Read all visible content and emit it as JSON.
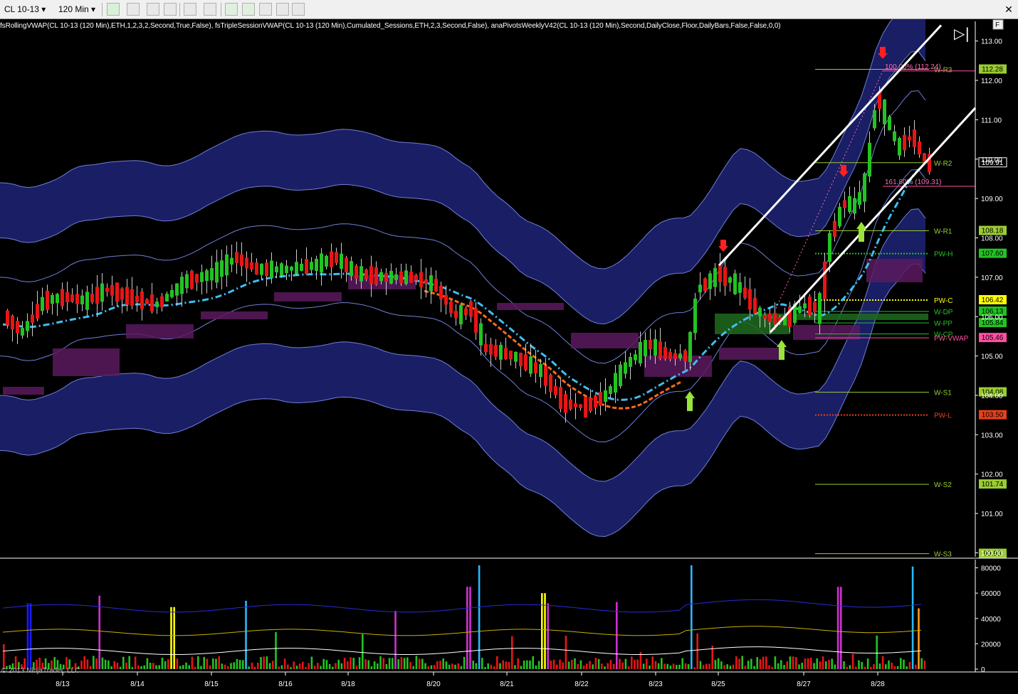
{
  "toolbar": {
    "instrument": "CL 10-13",
    "timeframe": "120 Min",
    "close_glyph": "✕",
    "buttons": [
      "bar-style-icon",
      "draw-pencil-icon",
      "draw-tools-icon",
      "properties-icon",
      "crosshair-icon",
      "zoom-icon",
      "chart-trader-icon",
      "data-box-icon",
      "indicators-icon",
      "strategies-icon",
      "template-icon"
    ]
  },
  "indicator_label": "fsRollingVWAP(CL 10-13 (120 Min),ETH,1,2,3,2,Second,True,False), fsTripleSessionVWAP(CL 10-13 (120 Min),Cumulated_Sessions,ETH,2,3,Second,False), anaPivotsWeeklyV42(CL 10-13 (120 Min),Second,DailyClose,Floor,DailyBars,False,False,0,0)",
  "colors": {
    "background": "#000000",
    "band_fill": "#1c2170",
    "band_line": "#6f7fd8",
    "up_candle": "#22c322",
    "down_candle": "#e81515",
    "vwap_rolling": "#3fbff3",
    "vwap_session": "#ff6b1a",
    "pivot_line": "#9acd32",
    "channel": "#ffffff",
    "supply_zone": "#5a1a5e",
    "demand_zone": "#1f6b1f"
  },
  "chart_data": {
    "type": "candlestick",
    "instrument": "CL 10-13",
    "timeframe": "120 Min",
    "ylim": [
      99.9,
      113.5
    ],
    "y_ticks": [
      "113.00",
      "112.00",
      "111.00",
      "110.00",
      "109.00",
      "108.00",
      "107.00",
      "106.00",
      "105.00",
      "104.00",
      "103.00",
      "102.00",
      "101.00",
      "100.00"
    ],
    "x_labels": [
      "8/13",
      "8/14",
      "8/15",
      "8/16",
      "8/18",
      "8/20",
      "8/21",
      "8/22",
      "8/23",
      "8/25",
      "8/27",
      "8/28"
    ],
    "pivot_levels": [
      {
        "name": "W-R3",
        "value": 112.28,
        "tag": "112.28",
        "label_color": "#9acd32",
        "tag_color": "#9acd32"
      },
      {
        "name": "W-R2",
        "value": 109.91,
        "tag": "109.91",
        "label_color": "#9acd32",
        "tag_color": "#000000"
      },
      {
        "name": "W-R1",
        "value": 108.18,
        "tag": "108.18",
        "label_color": "#9acd32",
        "tag_color": "#9acd32"
      },
      {
        "name": "PW-H",
        "value": 107.6,
        "tag": "107.60",
        "label_color": "#22c322",
        "tag_color": "#22c322"
      },
      {
        "name": "PW-C",
        "value": 106.42,
        "tag": "106.42",
        "label_color": "#ffff00",
        "tag_color": "#ffff00"
      },
      {
        "name": "W-DP",
        "value": 106.13,
        "tag": "106.13",
        "label_color": "#22c322",
        "tag_color": "#22c322"
      },
      {
        "name": "W-PP",
        "value": 105.84,
        "tag": "105.84",
        "label_color": "#22c322",
        "tag_color": "#22c322"
      },
      {
        "name": "W-CP",
        "value": 105.56,
        "tag": "",
        "label_color": "#22c322",
        "tag_color": "#22c322"
      },
      {
        "name": "PW-VWAP",
        "value": 105.46,
        "tag": "105.46",
        "label_color": "#ff4fa0",
        "tag_color": "#ff4fa0"
      },
      {
        "name": "W-S1",
        "value": 104.08,
        "tag": "104.08",
        "label_color": "#9acd32",
        "tag_color": "#9acd32"
      },
      {
        "name": "PW-L",
        "value": 103.5,
        "tag": "103.50",
        "label_color": "#e8401a",
        "tag_color": "#e8401a"
      },
      {
        "name": "W-S2",
        "value": 101.74,
        "tag": "101.74",
        "label_color": "#9acd32",
        "tag_color": "#9acd32"
      },
      {
        "name": "W-S3",
        "value": 99.98,
        "tag": "99.98",
        "label_color": "#9acd32",
        "tag_color": "#9acd32"
      }
    ],
    "fib_labels": [
      {
        "text": "100.00% (112.24)",
        "value": 112.24
      },
      {
        "text": "161.80% (109.31)",
        "value": 109.31
      }
    ],
    "volume": {
      "ylim": [
        0,
        82000
      ],
      "y_ticks": [
        "80000",
        "60000",
        "40000",
        "20000",
        "0"
      ]
    },
    "copyright": "© 2013 NinjaTrader, LLC"
  }
}
